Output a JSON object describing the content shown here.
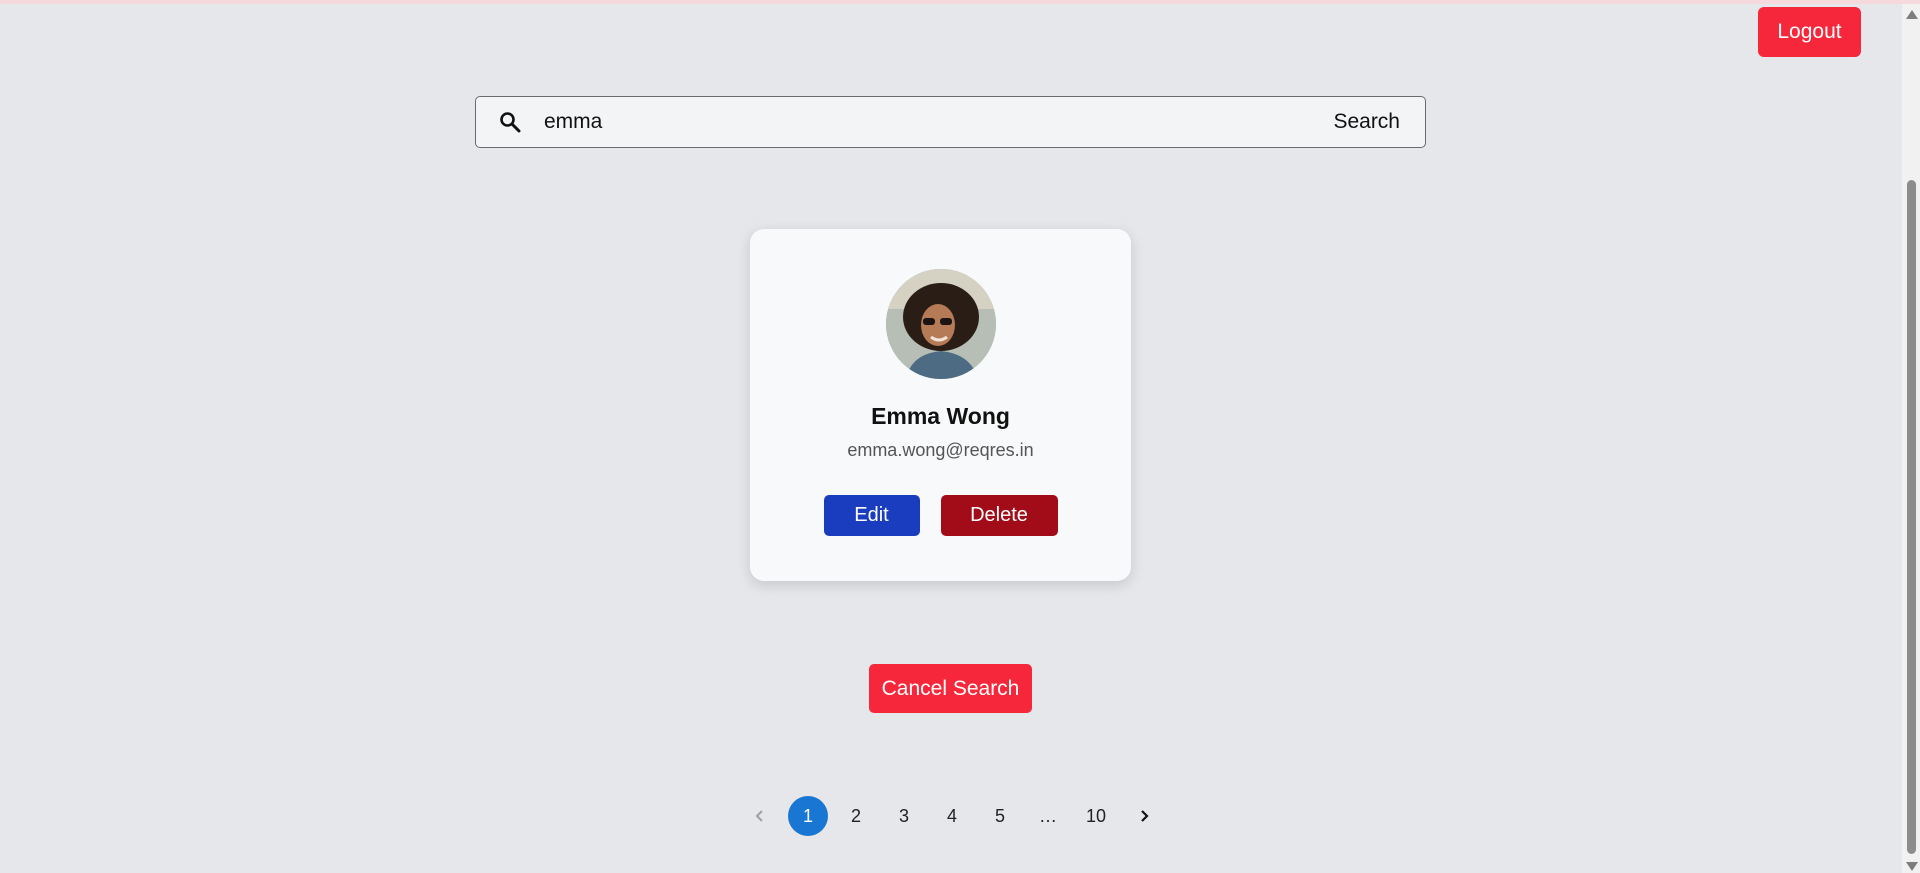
{
  "header": {
    "logout_label": "Logout"
  },
  "search": {
    "value": "emma",
    "button_label": "Search"
  },
  "user_card": {
    "name": "Emma Wong",
    "email": "emma.wong@reqres.in",
    "edit_label": "Edit",
    "delete_label": "Delete"
  },
  "cancel_search_label": "Cancel Search",
  "pagination": {
    "pages": [
      "1",
      "2",
      "3",
      "4",
      "5",
      "…",
      "10"
    ],
    "current": "1"
  },
  "colors": {
    "primary_red": "#f6273a",
    "edit_blue": "#1a3cbf",
    "delete_dark_red": "#a10c18",
    "active_page_blue": "#1976d2"
  }
}
